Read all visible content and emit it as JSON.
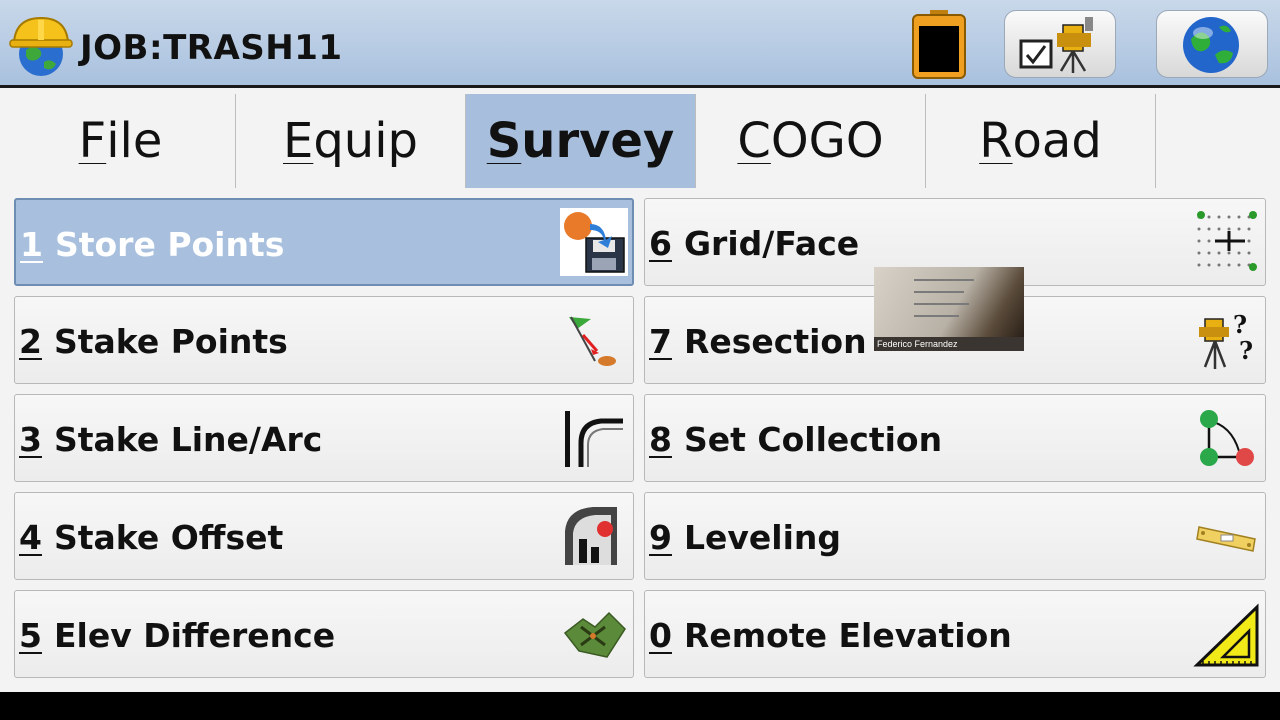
{
  "header": {
    "job_title": "JOB:TRASH11",
    "icons": [
      "hard-hat-globe-icon",
      "battery-icon",
      "instrument-check-icon",
      "globe-icon"
    ]
  },
  "tabs": [
    {
      "label": "File",
      "mnemonic": "F",
      "rest": "ile",
      "active": false
    },
    {
      "label": "Equip",
      "mnemonic": "E",
      "rest": "quip",
      "active": false
    },
    {
      "label": "Survey",
      "mnemonic": "S",
      "rest": "urvey",
      "active": true
    },
    {
      "label": "COGO",
      "mnemonic": "C",
      "rest": "OGO",
      "active": false
    },
    {
      "label": "Road",
      "mnemonic": "R",
      "rest": "oad",
      "active": false
    }
  ],
  "menu": [
    {
      "num": "1",
      "label": "Store Points",
      "icon": "store-points-icon",
      "selected": true
    },
    {
      "num": "2",
      "label": "Stake Points",
      "icon": "stake-points-icon",
      "selected": false
    },
    {
      "num": "3",
      "label": "Stake Line/Arc",
      "icon": "stake-line-arc-icon",
      "selected": false
    },
    {
      "num": "4",
      "label": "Stake Offset",
      "icon": "stake-offset-icon",
      "selected": false
    },
    {
      "num": "5",
      "label": "Elev Difference",
      "icon": "elev-difference-icon",
      "selected": false
    },
    {
      "num": "6",
      "label": "Grid/Face",
      "icon": "grid-face-icon",
      "selected": false
    },
    {
      "num": "7",
      "label": "Resection",
      "icon": "resection-icon",
      "selected": false
    },
    {
      "num": "8",
      "label": "Set Collection",
      "icon": "set-collection-icon",
      "selected": false
    },
    {
      "num": "9",
      "label": "Leveling",
      "icon": "leveling-icon",
      "selected": false
    },
    {
      "num": "0",
      "label": "Remote Elevation",
      "icon": "remote-elevation-icon",
      "selected": false
    }
  ],
  "overlay": {
    "caption": "Federico Fernandez"
  },
  "colors": {
    "header": "#b7cbe3",
    "selected": "#a8c0de",
    "tab_active": "#a7bfdd",
    "background": "#f3f3f3"
  }
}
